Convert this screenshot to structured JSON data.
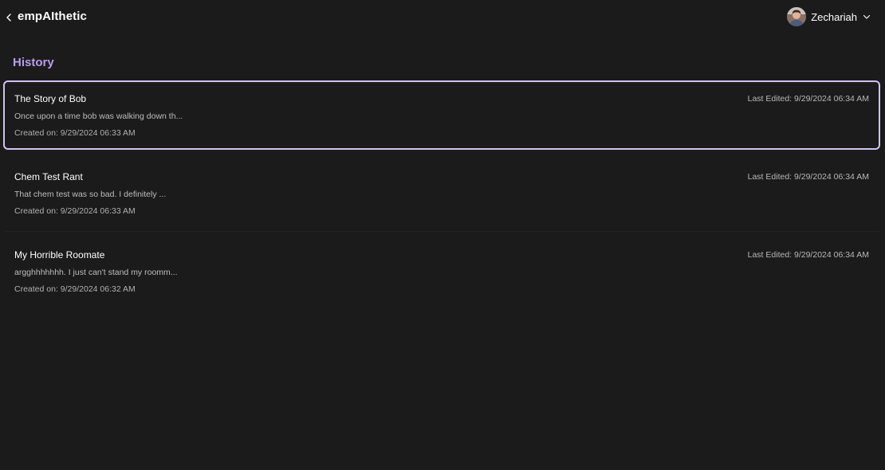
{
  "header": {
    "app_title": "empAIthetic",
    "user": {
      "name": "Zechariah"
    }
  },
  "page": {
    "heading": "History"
  },
  "history": [
    {
      "title": "The Story of Bob",
      "preview": "Once upon a time bob was walking down th...",
      "last_edited": "Last Edited: 9/29/2024 06:34 AM",
      "created": "Created on: 9/29/2024 06:33 AM"
    },
    {
      "title": "Chem Test Rant",
      "preview": "That chem test was so bad. I definitely ...",
      "last_edited": "Last Edited: 9/29/2024 06:34 AM",
      "created": "Created on: 9/29/2024 06:33 AM"
    },
    {
      "title": "My Horrible Roomate",
      "preview": "argghhhhhhh. I just can't stand my roomm...",
      "last_edited": "Last Edited: 9/29/2024 06:34 AM",
      "created": "Created on: 9/29/2024 06:32 AM"
    }
  ],
  "colors": {
    "background": "#1b1b1b",
    "accent": "#b79ef0",
    "selected_border": "#cfc2f5"
  }
}
